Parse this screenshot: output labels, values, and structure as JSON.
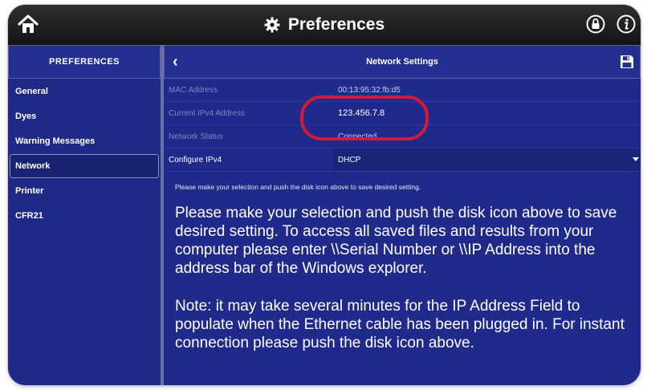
{
  "app": {
    "title": "Preferences"
  },
  "sidebar": {
    "header": "PREFERENCES",
    "items": [
      {
        "label": "General",
        "selected": false
      },
      {
        "label": "Dyes",
        "selected": false
      },
      {
        "label": "Warning Messages",
        "selected": false
      },
      {
        "label": "Network",
        "selected": true
      },
      {
        "label": "Printer",
        "selected": false
      },
      {
        "label": "CFR21",
        "selected": false
      }
    ]
  },
  "main": {
    "title": "Network Settings",
    "rows": [
      {
        "label": "MAC Address",
        "value": "00:13:95:32:fb:d5"
      },
      {
        "label": "Current IPv4 Address",
        "value": "123.456.7.8"
      },
      {
        "label": "Network Status",
        "value": "Connected"
      },
      {
        "label": "Configure IPv4",
        "value": "DHCP"
      }
    ],
    "small_note": "Please make your selection and push the disk icon above to save desired setting.",
    "paragraph1": "Please make your selection and push the disk icon above to save desired setting. To access all saved files and results from your computer please enter \\\\Serial Number or \\\\IP Address into the address bar of the Windows explorer.",
    "paragraph2": "Note: it may take several minutes for the IP Address Field to populate when the Ethernet cable has been plugged in. For instant connection please push the disk icon above."
  },
  "colors": {
    "panel": "#1f2a8a",
    "topbar": "#1c1c1c",
    "highlight_ring": "#d21a3a"
  },
  "icons": {
    "home": "home-icon",
    "gear": "gear-icon",
    "lock": "lock-icon",
    "info": "info-icon",
    "back": "chevron-left-icon",
    "save": "disk-icon"
  }
}
